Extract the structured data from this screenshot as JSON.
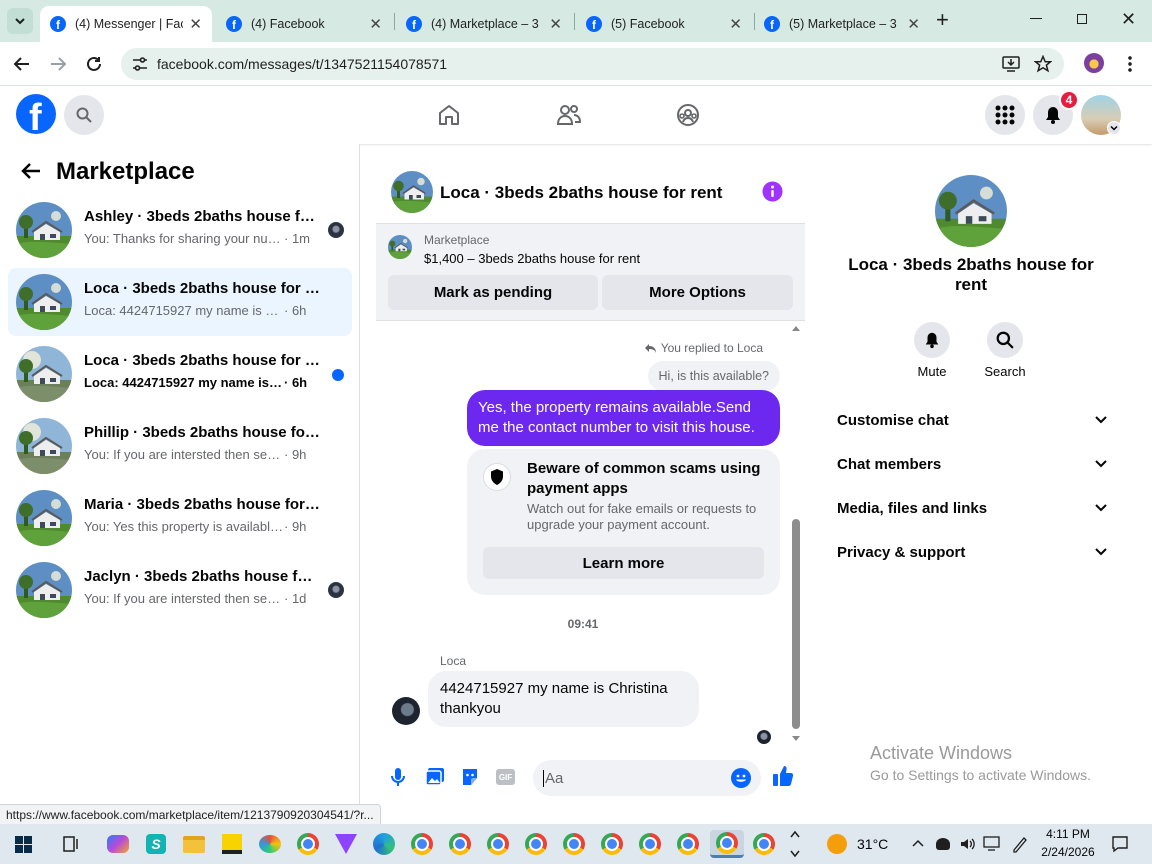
{
  "browser": {
    "tabs": [
      {
        "title": "(4) Messenger | Face",
        "active": true
      },
      {
        "title": "(4) Facebook",
        "active": false
      },
      {
        "title": "(4) Marketplace – 3b",
        "active": false
      },
      {
        "title": "(5) Facebook",
        "active": false
      },
      {
        "title": "(5) Marketplace – 3b",
        "active": false
      }
    ],
    "url": "facebook.com/messages/t/1347521154078571",
    "status_url": "https://www.facebook.com/marketplace/item/1213790920304541/?r..."
  },
  "header": {
    "notification_count": "4"
  },
  "sidebar": {
    "title": "Marketplace",
    "conversations": [
      {
        "title": "Ashley · 3beds 2baths house for...",
        "preview": "You: Thanks for sharing your num...",
        "time": "· 1m",
        "selected": false,
        "unread": false,
        "indicator": "avatar"
      },
      {
        "title": "Loca · 3beds 2baths house for rent",
        "preview": "Loca: 4424715927 my name is Christi...",
        "time": "· 6h",
        "selected": true,
        "unread": false,
        "indicator": "none"
      },
      {
        "title": "Loca · 3beds 2baths house for rent",
        "preview": "Loca: 4424715927 my name is Chri...",
        "time": "· 6h",
        "selected": false,
        "unread": true,
        "indicator": "dot"
      },
      {
        "title": "Phillip · 3beds 2baths house for rent",
        "preview": "You: If you are intersted then send yo...",
        "time": "· 9h",
        "selected": false,
        "unread": false,
        "indicator": "none"
      },
      {
        "title": "Maria · 3beds 2baths house for rent",
        "preview": "You: Yes this property is available. For ...",
        "time": "· 9h",
        "selected": false,
        "unread": false,
        "indicator": "none"
      },
      {
        "title": "Jaclyn · 3beds 2baths house for ...",
        "preview": "You: If you are intersted then send ...",
        "time": "· 1d",
        "selected": false,
        "unread": false,
        "indicator": "avatar"
      }
    ]
  },
  "chat": {
    "title": "Loca · 3beds 2baths house for rent",
    "marketplace_label": "Marketplace",
    "listing": "$1,400 – 3beds 2baths house for rent",
    "mark_pending": "Mark as pending",
    "more_options": "More Options",
    "replied_label": "You replied to Loca",
    "quoted": "Hi, is this available?",
    "sent_message": "Yes, the property remains available.Send me the contact number to visit this house.",
    "scam_title": "Beware of common scams using payment apps",
    "scam_body": "Watch out for fake emails or requests to upgrade your payment account.",
    "learn_more": "Learn more",
    "timestamp": "09:41",
    "sender": "Loca",
    "received_message": "4424715927 my name is Christina thankyou",
    "input_placeholder": "Aa"
  },
  "details": {
    "title": "Loca · 3beds 2baths house for rent",
    "mute": "Mute",
    "search": "Search",
    "options": [
      "Customise chat",
      "Chat members",
      "Media, files and links",
      "Privacy & support"
    ]
  },
  "watermark": {
    "line1": "Activate Windows",
    "line2": "Go to Settings to activate Windows."
  },
  "taskbar": {
    "temperature": "31°C",
    "time": "4:11 PM",
    "date": "2/24/2026"
  },
  "colors": {
    "accent": "#0866ff",
    "sent_bubble": "#6d28f0",
    "messenger_purple": "#a033ff",
    "badge": "#e41e3f"
  }
}
